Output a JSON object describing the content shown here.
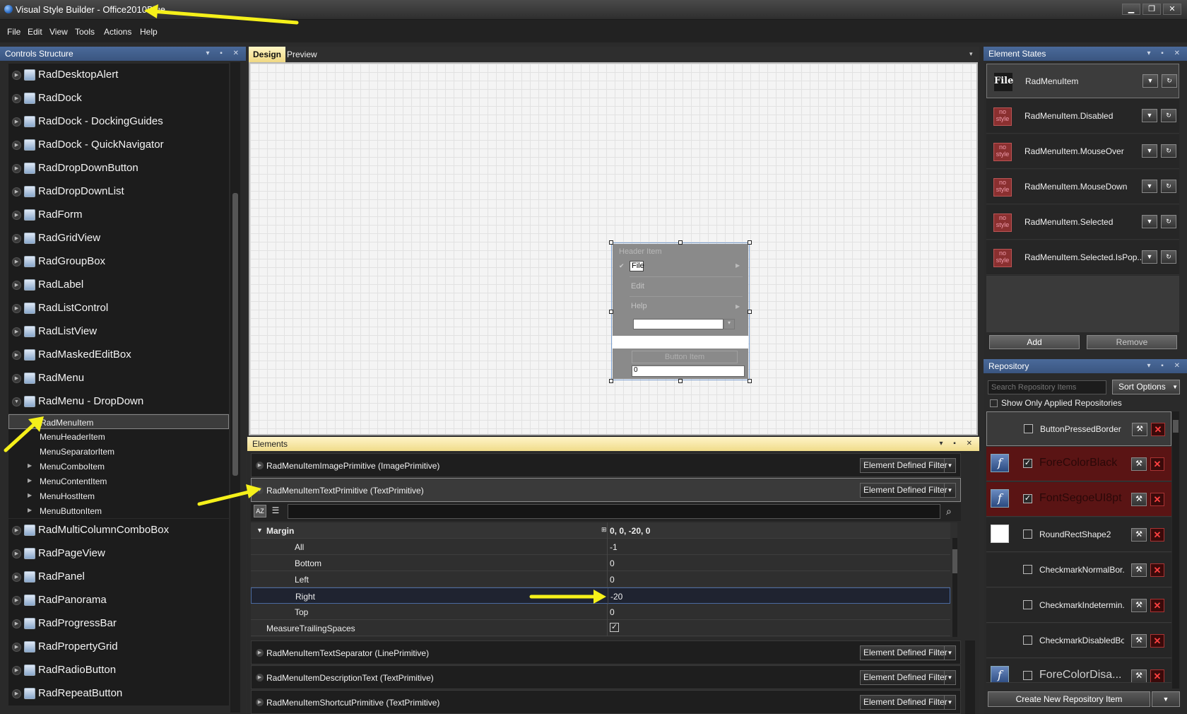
{
  "window": {
    "title": "Visual Style Builder - Office2010Blue",
    "min_label": "▁",
    "max_label": "❐",
    "close_label": "✕"
  },
  "menu": [
    "File",
    "Edit",
    "View",
    "Tools",
    "Actions",
    "Help"
  ],
  "controls_structure": {
    "title": "Controls Structure",
    "items": [
      {
        "label": "RadDesktopAlert"
      },
      {
        "label": "RadDock"
      },
      {
        "label": "RadDock - DockingGuides"
      },
      {
        "label": "RadDock - QuickNavigator"
      },
      {
        "label": "RadDropDownButton"
      },
      {
        "label": "RadDropDownList"
      },
      {
        "label": "RadForm"
      },
      {
        "label": "RadGridView"
      },
      {
        "label": "RadGroupBox"
      },
      {
        "label": "RadLabel"
      },
      {
        "label": "RadListControl"
      },
      {
        "label": "RadListView"
      },
      {
        "label": "RadMaskedEditBox"
      },
      {
        "label": "RadMenu"
      },
      {
        "label": "RadMenu - DropDown"
      }
    ],
    "subitems": [
      "RadMenuItem",
      "MenuHeaderItem",
      "MenuSeparatorItem",
      "MenuComboItem",
      "MenuContentItem",
      "MenuHostItem",
      "MenuButtonItem"
    ],
    "items_after": [
      {
        "label": "RadMultiColumnComboBox"
      },
      {
        "label": "RadPageView"
      },
      {
        "label": "RadPanel"
      },
      {
        "label": "RadPanorama"
      },
      {
        "label": "RadProgressBar"
      },
      {
        "label": "RadPropertyGrid"
      },
      {
        "label": "RadRadioButton"
      },
      {
        "label": "RadRepeatButton"
      }
    ]
  },
  "tabs": {
    "design": "Design",
    "preview": "Preview"
  },
  "preview": {
    "header": "Header Item",
    "file": "File",
    "edit": "Edit",
    "help": "Help",
    "button": "Button Item",
    "textbox_value": "0"
  },
  "elements": {
    "title": "Elements",
    "rows_top": [
      {
        "label": "RadMenuItemImagePrimitive (ImagePrimitive)",
        "filter": "Element Defined Filter"
      },
      {
        "label": "RadMenuItemTextPrimitive (TextPrimitive)",
        "filter": "Element Defined Filter"
      }
    ],
    "properties": {
      "margin_label": "Margin",
      "margin_value": "0, 0, -20, 0",
      "rows": [
        {
          "name": "All",
          "value": "-1"
        },
        {
          "name": "Bottom",
          "value": "0"
        },
        {
          "name": "Left",
          "value": "0"
        },
        {
          "name": "Right",
          "value": "-20"
        },
        {
          "name": "Top",
          "value": "0"
        }
      ],
      "measure_label": "MeasureTrailingSpaces",
      "measure_checked": "✓"
    },
    "rows_bottom": [
      {
        "label": "RadMenuItemTextSeparator (LinePrimitive)",
        "filter": "Element Defined Filter"
      },
      {
        "label": "RadMenuItemDescriptionText (TextPrimitive)",
        "filter": "Element Defined Filter"
      },
      {
        "label": "RadMenuItemShortcutPrimitive (TextPrimitive)",
        "filter": "Element Defined Filter"
      }
    ]
  },
  "element_states": {
    "title": "Element States",
    "file_icon": "File",
    "nostyle_icon": "no style",
    "states": [
      "RadMenuItem",
      "RadMenuItem.Disabled",
      "RadMenuItem.MouseOver",
      "RadMenuItem.MouseDown",
      "RadMenuItem.Selected",
      "RadMenuItem.Selected.IsPop..."
    ],
    "add": "Add",
    "remove": "Remove"
  },
  "repository": {
    "title": "Repository",
    "search_placeholder": "Search Repository Items",
    "sort": "Sort Options",
    "show_applied": "Show Only Applied Repositories",
    "items": [
      {
        "label": "ButtonPressedBorder",
        "checked": "",
        "style": "plain"
      },
      {
        "label": "ForeColorBlack",
        "checked": "✓",
        "style": "fx"
      },
      {
        "label": "FontSegoeUI8pt",
        "checked": "✓",
        "style": "fx"
      },
      {
        "label": "RoundRectShape2",
        "checked": "",
        "style": "white"
      },
      {
        "label": "CheckmarkNormalBor...",
        "checked": "",
        "style": "plain"
      },
      {
        "label": "CheckmarkIndetermin...",
        "checked": "",
        "style": "plain"
      },
      {
        "label": "CheckmarkDisabledBo...",
        "checked": "",
        "style": "plain"
      },
      {
        "label": "ForeColorDisa...",
        "checked": "",
        "style": "fx"
      }
    ],
    "create": "Create New Repository Item"
  },
  "colors": {
    "accent_yellow": "#f5f01a",
    "panel_blue": "#3a5580",
    "red_row": "#5a1414"
  }
}
